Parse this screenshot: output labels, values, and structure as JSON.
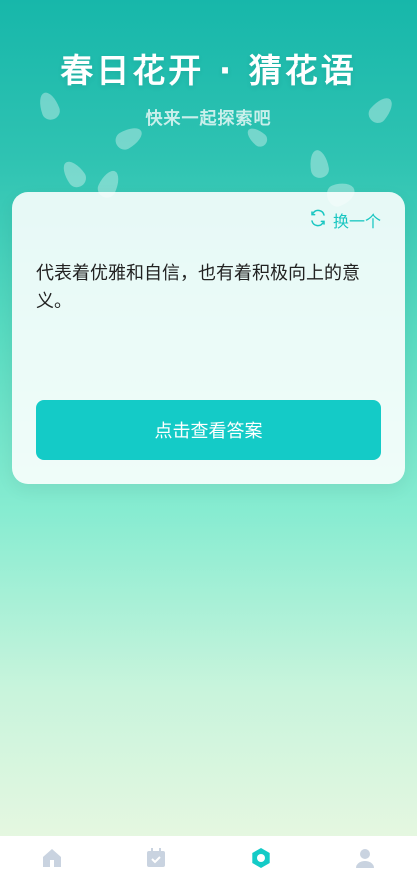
{
  "header": {
    "title": "春日花开 · 猜花语",
    "subtitle": "快来一起探索吧"
  },
  "card": {
    "refresh_label": "换一个",
    "clue": "代表着优雅和自信，也有着积极向上的意义。",
    "reveal_label": "点击查看答案"
  },
  "tabbar": {
    "items": [
      {
        "icon": "home-icon",
        "active": false
      },
      {
        "icon": "calendar-check-icon",
        "active": false
      },
      {
        "icon": "flower-icon",
        "active": true
      },
      {
        "icon": "user-icon",
        "active": false
      }
    ],
    "colors": {
      "active": "#14cbc7",
      "inactive": "#c9d3e0"
    }
  }
}
